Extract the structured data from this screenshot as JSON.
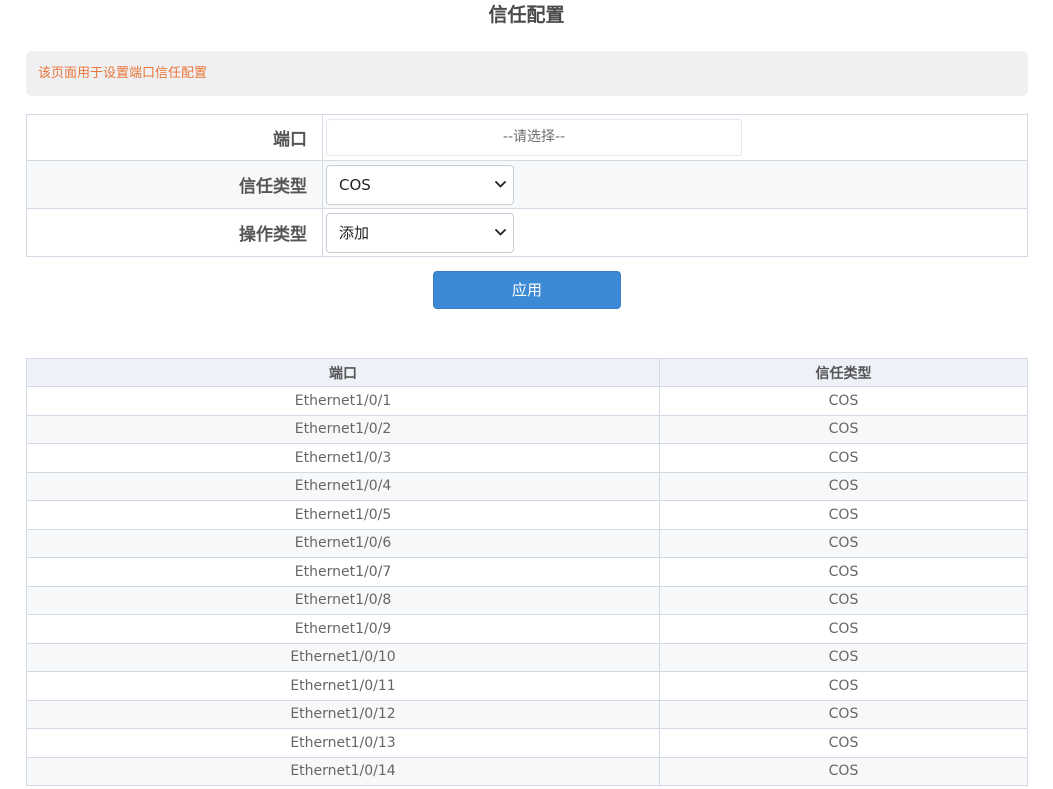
{
  "page": {
    "title": "信任配置",
    "notice": "该页面用于设置端口信任配置"
  },
  "form": {
    "port": {
      "label": "端口",
      "placeholder": "--请选择--"
    },
    "trust_type": {
      "label": "信任类型",
      "selected": "COS"
    },
    "operation_type": {
      "label": "操作类型",
      "selected": "添加"
    },
    "apply_label": "应用"
  },
  "table": {
    "headers": {
      "port": "端口",
      "trust_type": "信任类型"
    },
    "rows": [
      {
        "port": "Ethernet1/0/1",
        "trust_type": "COS"
      },
      {
        "port": "Ethernet1/0/2",
        "trust_type": "COS"
      },
      {
        "port": "Ethernet1/0/3",
        "trust_type": "COS"
      },
      {
        "port": "Ethernet1/0/4",
        "trust_type": "COS"
      },
      {
        "port": "Ethernet1/0/5",
        "trust_type": "COS"
      },
      {
        "port": "Ethernet1/0/6",
        "trust_type": "COS"
      },
      {
        "port": "Ethernet1/0/7",
        "trust_type": "COS"
      },
      {
        "port": "Ethernet1/0/8",
        "trust_type": "COS"
      },
      {
        "port": "Ethernet1/0/9",
        "trust_type": "COS"
      },
      {
        "port": "Ethernet1/0/10",
        "trust_type": "COS"
      },
      {
        "port": "Ethernet1/0/11",
        "trust_type": "COS"
      },
      {
        "port": "Ethernet1/0/12",
        "trust_type": "COS"
      },
      {
        "port": "Ethernet1/0/13",
        "trust_type": "COS"
      },
      {
        "port": "Ethernet1/0/14",
        "trust_type": "COS"
      }
    ]
  },
  "colors": {
    "notice_text": "#e8763a",
    "apply_button": "#3c8ad6",
    "border": "#d3dae6"
  },
  "icons": {
    "select_arrow": "chevron-down-icon"
  }
}
